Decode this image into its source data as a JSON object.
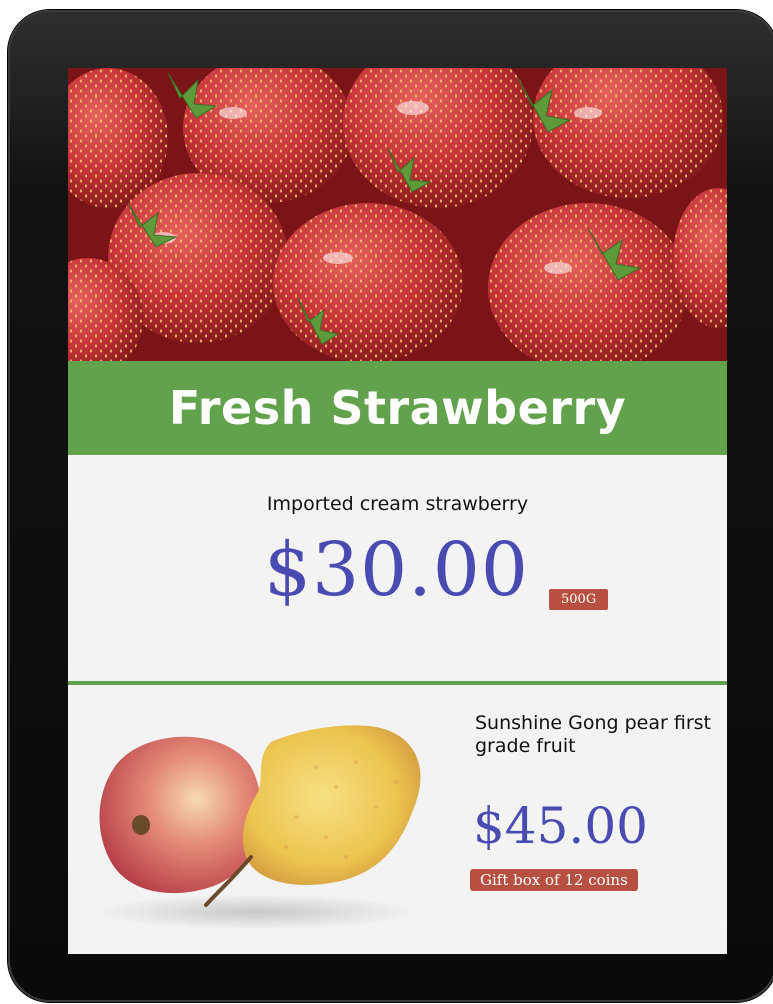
{
  "banner": {
    "title": "Fresh Strawberry"
  },
  "promo_primary": {
    "subtitle": "Imported cream strawberry",
    "price": "$30.00",
    "badge": "500G"
  },
  "promo_secondary": {
    "title": "Sunshine Gong pear first grade fruit",
    "price": "$45.00",
    "badge": "Gift box of 12 coins"
  },
  "colors": {
    "banner_green": "#63a24c",
    "price_blue": "#4a4ab3",
    "badge_red": "#b85042",
    "screen_bg": "#f3f3f3",
    "bezel": "#0a0a0a"
  },
  "images": {
    "hero": "strawberries-photo",
    "secondary": "apple-and-pear-photo"
  }
}
